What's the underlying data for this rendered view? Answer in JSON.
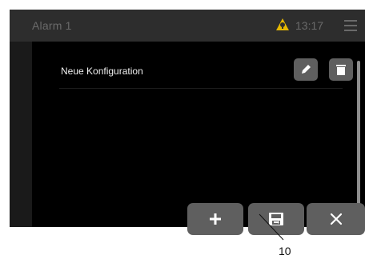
{
  "header": {
    "title": "Alarm 1",
    "time": "13:17",
    "alarm_icon": "alarm-bell-warning-icon",
    "menu_icon": "hamburger-menu-icon"
  },
  "config_list": {
    "items": [
      {
        "label": "Neue Konfiguration",
        "actions": [
          "edit-pencil-icon",
          "delete-trash-icon"
        ]
      }
    ]
  },
  "bottom_bar": {
    "buttons": [
      {
        "name": "add",
        "icon": "plus-icon"
      },
      {
        "name": "save",
        "icon": "save-floppy-icon"
      },
      {
        "name": "cancel",
        "icon": "close-x-icon"
      }
    ]
  },
  "callout": {
    "number": "10"
  },
  "colors": {
    "header_bg": "#2d2d2d",
    "panel_bg": "#000000",
    "button_bg": "#5f5f5f",
    "alarm_yellow": "#e6b800",
    "muted_text": "#6a6a6a"
  }
}
